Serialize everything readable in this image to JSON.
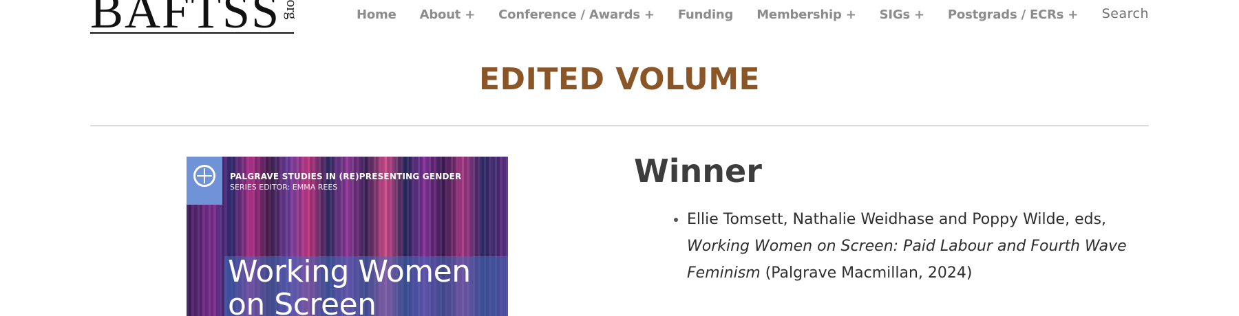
{
  "header": {
    "logo_text": "BAFTSS",
    "logo_suffix": ".org",
    "nav": [
      {
        "label": "Home"
      },
      {
        "label": "About +"
      },
      {
        "label": "Conference / Awards +"
      },
      {
        "label": "Funding"
      },
      {
        "label": "Membership +"
      },
      {
        "label": "SIGs +"
      },
      {
        "label": "Postgrads / ECRs +"
      }
    ],
    "search_label": "Search"
  },
  "section": {
    "title": "EDITED VOLUME"
  },
  "cover": {
    "series": "PALGRAVE STUDIES IN (RE)PRESENTING GENDER",
    "editor": "SERIES EDITOR: EMMA REES",
    "title_line1": "Working Women",
    "title_line2": "on Screen"
  },
  "award": {
    "heading": "Winner",
    "entries": [
      {
        "authors": "Ellie Tomsett, Nathalie Weidhase and Poppy Wilde, eds,",
        "title": "Working Women on Screen: Paid Labour and Fourth Wave Feminism",
        "publisher": "(Palgrave Macmillan, 2024)"
      }
    ]
  },
  "colors": {
    "accent": "#8a5628",
    "nav_text": "#8c8c8c",
    "heading": "#3d3d3d",
    "divider": "#dcdcdc"
  },
  "icons": {
    "cover_logo": "palgrave-logo-icon"
  }
}
